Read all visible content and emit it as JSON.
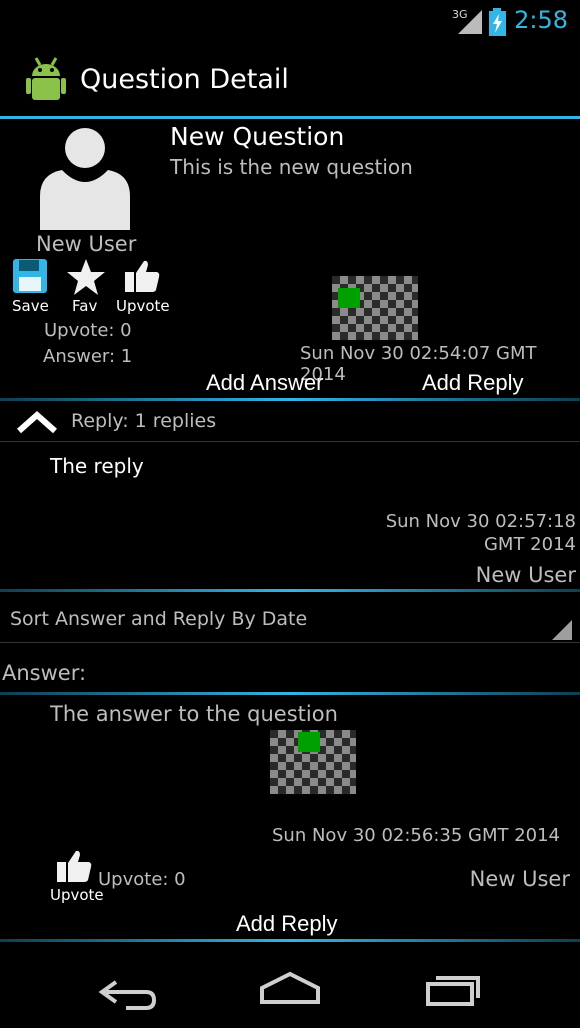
{
  "status_bar": {
    "network": "3G",
    "time": "2:58"
  },
  "action_bar": {
    "title": "Question Detail"
  },
  "question": {
    "title": "New Question",
    "body": "This is the new question",
    "author": "New User",
    "actions": {
      "save": "Save",
      "fav": "Fav",
      "upvote": "Upvote"
    },
    "upvote_count": "Upvote: 0",
    "answer_count": "Answer: 1",
    "timestamp": "Sun Nov 30 02:54:07 GMT 2014",
    "add_answer": "Add Answer",
    "add_reply": "Add Reply"
  },
  "replies": {
    "header": "Reply: 1 replies",
    "items": [
      {
        "text": "The reply",
        "timestamp_line1": "Sun Nov 30 02:57:18",
        "timestamp_line2": "GMT 2014",
        "author": "New User"
      }
    ]
  },
  "sort": {
    "selected": "Sort Answer and Reply By Date"
  },
  "answers": {
    "label": "Answer:",
    "items": [
      {
        "text": "The answer to the question",
        "timestamp": "Sun Nov 30 02:56:35 GMT 2014",
        "upvote_label": "Upvote",
        "upvote_count": "Upvote: 0",
        "author": "New User",
        "add_reply": "Add Reply"
      }
    ]
  },
  "colors": {
    "accent": "#33b5e5",
    "green": "#00a000"
  }
}
